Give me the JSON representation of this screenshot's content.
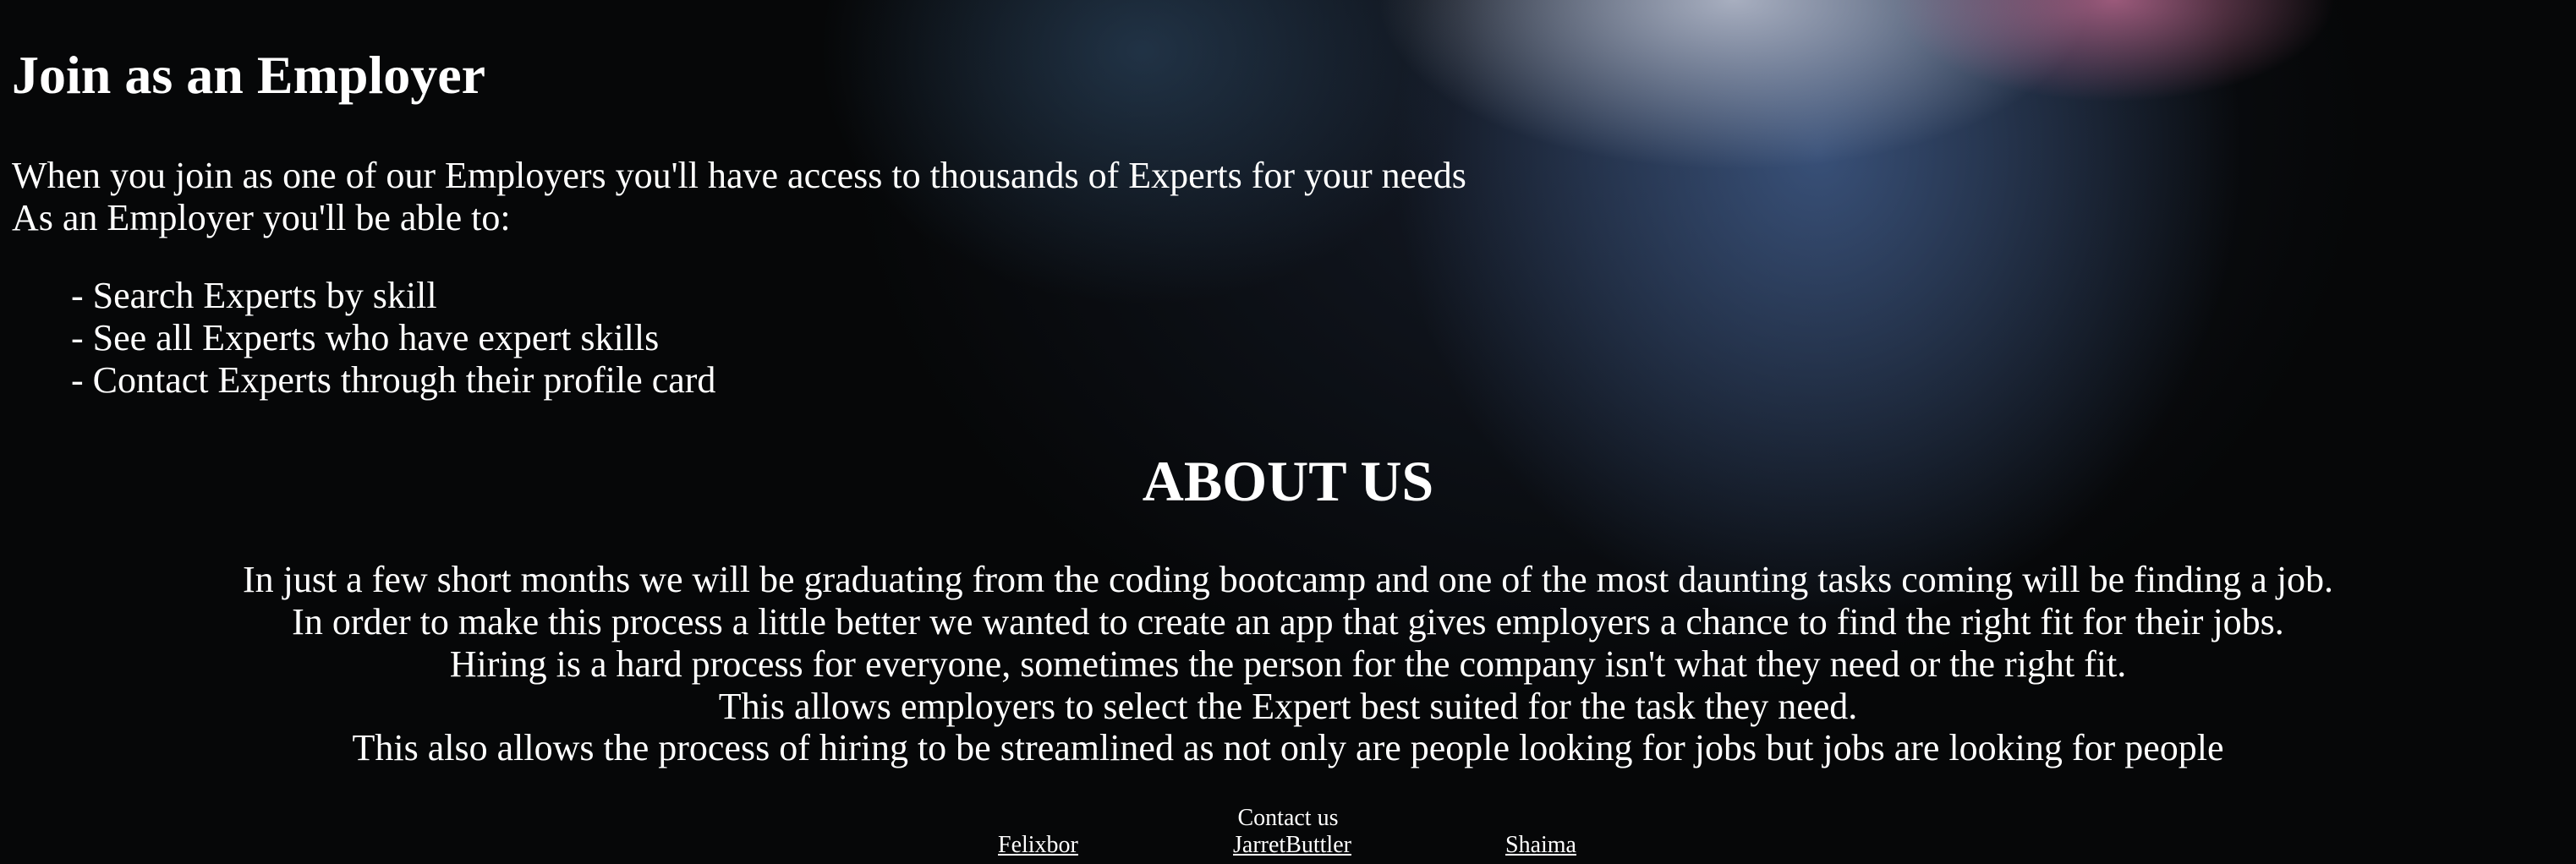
{
  "employer": {
    "title": "Join as an Employer",
    "intro": "When you join as one of our Employers you'll have access to thousands of Experts for your needs",
    "able_to": "As an Employer you'll be able to:",
    "abilities": [
      "- Search Experts by skill",
      "- See all Experts who have expert skills",
      "- Contact Experts through their profile card"
    ]
  },
  "about": {
    "title": "ABOUT US",
    "lines": [
      "In just a few short months we will be graduating from the coding bootcamp and one of the most daunting tasks coming will be finding a job.",
      "In order to make this process a little better we wanted to create an app that gives employers a chance to find the right fit for their jobs.",
      "Hiring is a hard process for everyone, sometimes the person for the company isn't what they need or the right fit.",
      "This allows employers to select the Expert best suited for the task they need.",
      "This also allows the process of hiring to be streamlined as not only are people looking for jobs but jobs are looking for people"
    ]
  },
  "footer": {
    "contact": "Contact us",
    "links": [
      "Felixbor",
      "JarretButtler",
      "Shaima"
    ]
  }
}
